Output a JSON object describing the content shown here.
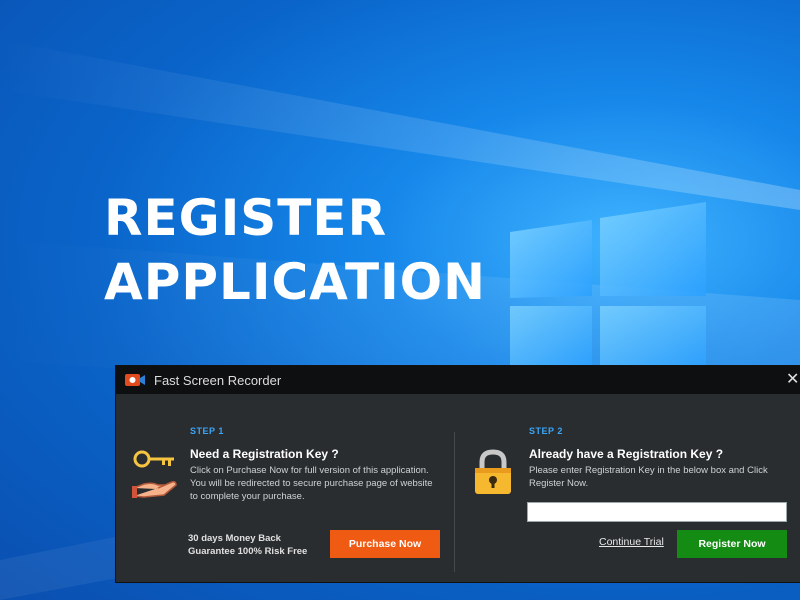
{
  "hero": {
    "line1": "REGISTER",
    "line2": "APPLICATION"
  },
  "colors": {
    "accent_blue": "#3ba5f5",
    "purchase": "#f05b14",
    "register": "#148c14",
    "dialog_bg": "#2a2d30"
  },
  "dialog": {
    "title": "Fast Screen Recorder",
    "close_glyph": "✕",
    "left": {
      "step": "STEP 1",
      "heading": "Need a Registration Key ?",
      "description": "Click on Purchase Now for full version of this application. You will be redirected to secure purchase page of website to complete your purchase.",
      "money_back_line1": "30 days Money Back",
      "money_back_line2": "Guarantee 100% Risk Free",
      "purchase_button": "Purchase Now",
      "icon": "key-hand-icon"
    },
    "right": {
      "step": "STEP 2",
      "heading": "Already have a Registration Key ?",
      "description": "Please enter Registration Key in the below box and Click Register Now.",
      "key_input_value": "",
      "continue_link": "Continue Trial",
      "register_button": "Register Now",
      "icon": "padlock-icon"
    }
  }
}
